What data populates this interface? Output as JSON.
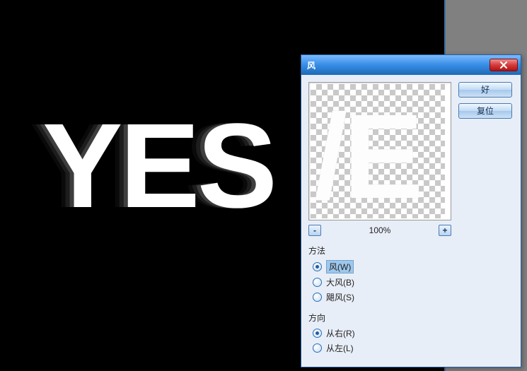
{
  "canvas": {
    "text": "YES"
  },
  "dialog": {
    "title": "风",
    "preview_text": "/E",
    "zoom": {
      "minus": "-",
      "plus": "+",
      "value": "100%"
    },
    "buttons": {
      "ok": "好",
      "reset": "复位"
    },
    "method": {
      "title": "方法",
      "options": {
        "wind": "风(W)",
        "blast": "大风(B)",
        "stagger": "飓风(S)"
      },
      "selected": "wind"
    },
    "direction": {
      "title": "方向",
      "options": {
        "from_right": "从右(R)",
        "from_left": "从左(L)"
      },
      "selected": "from_right"
    }
  }
}
